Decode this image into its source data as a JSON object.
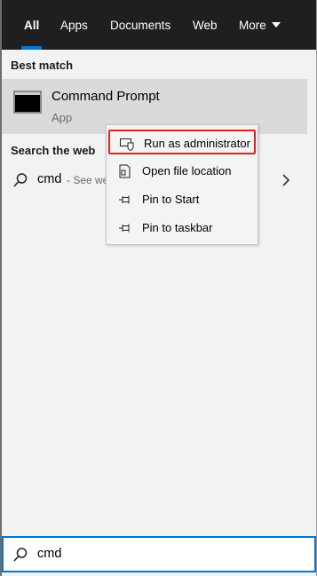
{
  "tabs": [
    {
      "label": "All",
      "active": true
    },
    {
      "label": "Apps"
    },
    {
      "label": "Documents"
    },
    {
      "label": "Web"
    },
    {
      "label": "More"
    }
  ],
  "best_match": {
    "section_label": "Best match",
    "name": "Command Prompt",
    "type": "App",
    "icon": "cmd-terminal-icon"
  },
  "search_web": {
    "section_label": "Search the web",
    "query": "cmd",
    "suffix": "- See we",
    "icon": "search-icon"
  },
  "context_menu": {
    "items": [
      {
        "label": "Run as administrator",
        "icon": "shield-icon",
        "highlighted": true
      },
      {
        "label": "Open file location",
        "icon": "file-location-icon"
      },
      {
        "label": "Pin to Start",
        "icon": "pin-icon"
      },
      {
        "label": "Pin to taskbar",
        "icon": "pin-icon"
      }
    ]
  },
  "search_box": {
    "value": "cmd",
    "icon": "search-icon"
  },
  "colors": {
    "accent": "#0078d7",
    "highlight_border": "#e0231c",
    "tab_bar_bg": "#1f1f1f",
    "selected_item_bg": "#dadada"
  }
}
